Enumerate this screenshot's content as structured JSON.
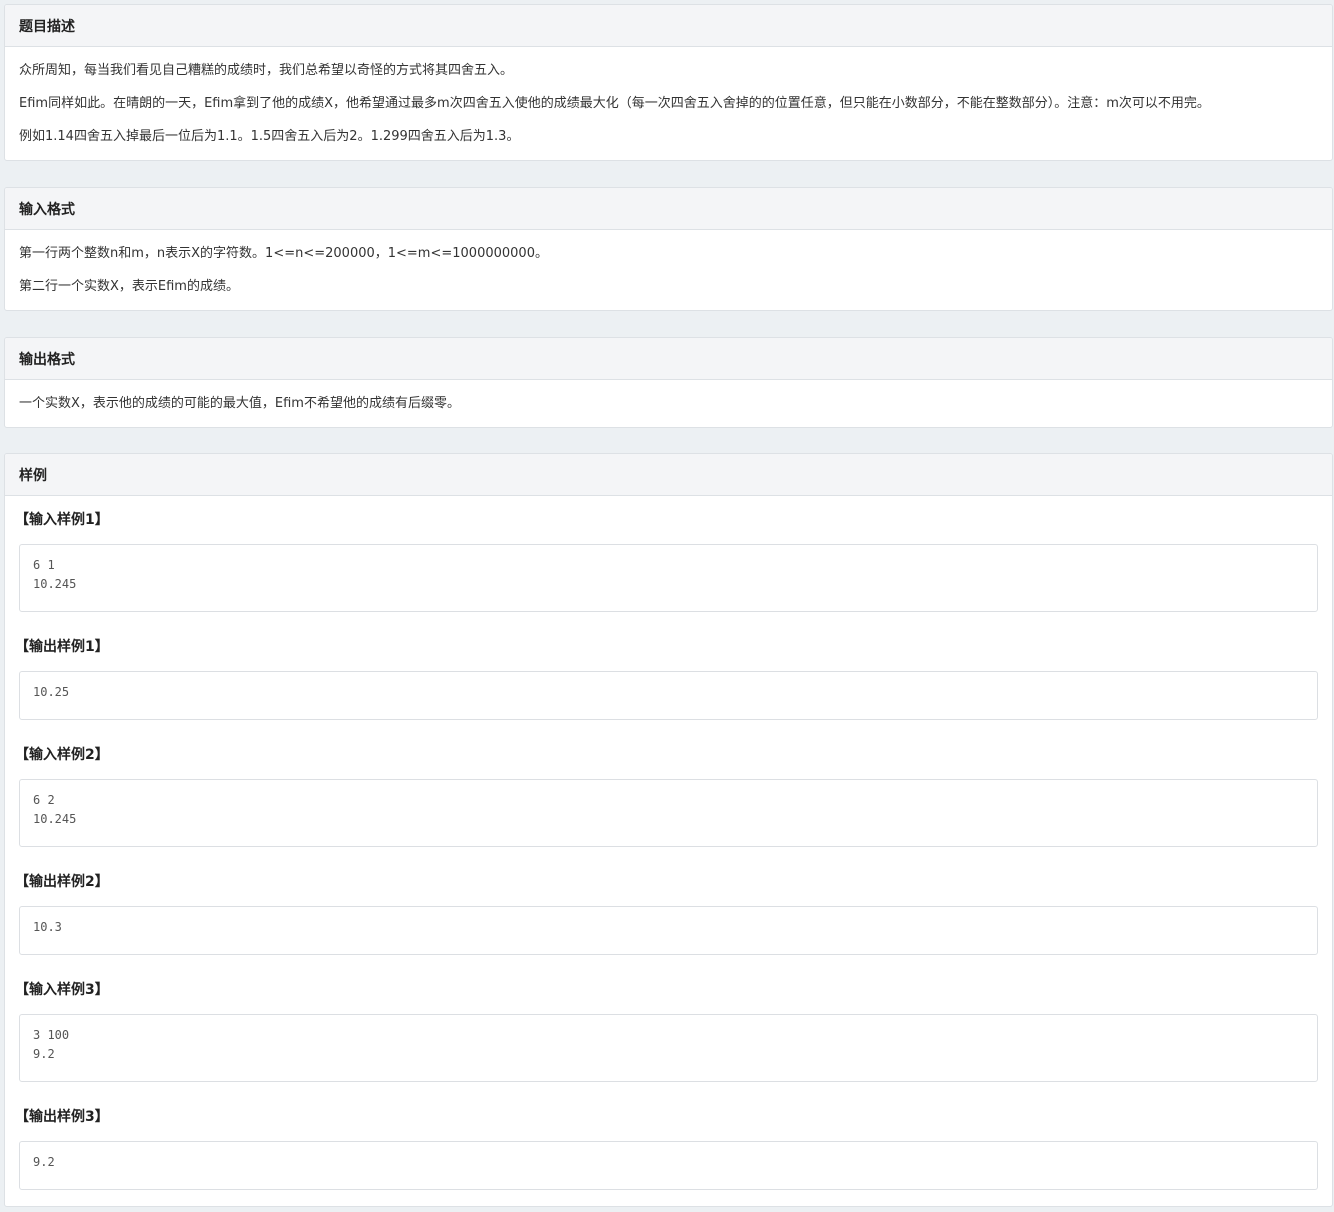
{
  "description": {
    "title": "题目描述",
    "paragraphs": [
      "众所周知，每当我们看见自己糟糕的成绩时，我们总希望以奇怪的方式将其四舍五入。",
      "Efim同样如此。在晴朗的一天，Efim拿到了他的成绩X，他希望通过最多m次四舍五入使他的成绩最大化（每一次四舍五入舍掉的的位置任意，但只能在小数部分，不能在整数部分）。注意：m次可以不用完。",
      "例如1.14四舍五入掉最后一位后为1.1。1.5四舍五入后为2。1.299四舍五入后为1.3。"
    ]
  },
  "input_format": {
    "title": "输入格式",
    "paragraphs": [
      "第一行两个整数n和m，n表示X的字符数。1<=n<=200000，1<=m<=1000000000。",
      "第二行一个实数X，表示Efim的成绩。"
    ]
  },
  "output_format": {
    "title": "输出格式",
    "paragraphs": [
      "一个实数X，表示他的成绩的可能的最大值，Efim不希望他的成绩有后缀零。"
    ]
  },
  "samples": {
    "title": "样例",
    "items": [
      {
        "label": "【输入样例1】",
        "content": "6 1\n10.245"
      },
      {
        "label": "【输出样例1】",
        "content": "10.25"
      },
      {
        "label": "【输入样例2】",
        "content": "6 2\n10.245"
      },
      {
        "label": "【输出样例2】",
        "content": "10.3"
      },
      {
        "label": "【输入样例3】",
        "content": "3 100\n9.2"
      },
      {
        "label": "【输出样例3】",
        "content": "9.2"
      }
    ]
  }
}
